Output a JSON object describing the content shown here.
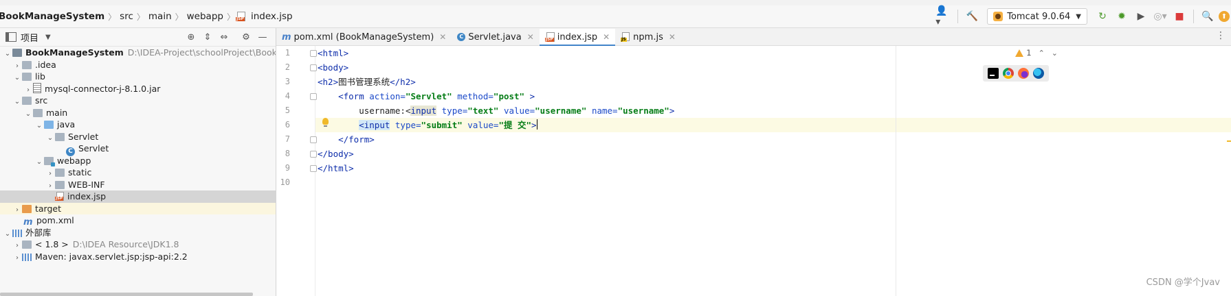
{
  "breadcrumbs": [
    "BookManageSystem",
    "src",
    "main",
    "webapp",
    "index.jsp"
  ],
  "toolbar": {
    "run_config": "Tomcat 9.0.64"
  },
  "project_panel": {
    "title": "项目",
    "tree": [
      {
        "label": "BookManageSystem",
        "path": "D:\\IDEA-Project\\schoolProject\\BookManageSyste",
        "icon": "project-folder-icon"
      },
      {
        "label": ".idea",
        "icon": "folder-icon"
      },
      {
        "label": "lib",
        "icon": "folder-icon"
      },
      {
        "label": "mysql-connector-j-8.1.0.jar",
        "icon": "jar-icon"
      },
      {
        "label": "src",
        "icon": "folder-icon"
      },
      {
        "label": "main",
        "icon": "folder-icon"
      },
      {
        "label": "java",
        "icon": "source-folder-icon"
      },
      {
        "label": "Servlet",
        "icon": "package-icon"
      },
      {
        "label": "Servlet",
        "icon": "class-icon"
      },
      {
        "label": "webapp",
        "icon": "web-folder-icon"
      },
      {
        "label": "static",
        "icon": "folder-icon"
      },
      {
        "label": "WEB-INF",
        "icon": "folder-icon"
      },
      {
        "label": "index.jsp",
        "icon": "jsp-file-icon"
      },
      {
        "label": "target",
        "icon": "excluded-folder-icon"
      },
      {
        "label": "pom.xml",
        "icon": "maven-icon"
      },
      {
        "label": "外部库",
        "icon": "libraries-icon"
      },
      {
        "label": "< 1.8 >",
        "path": "D:\\IDEA Resource\\JDK1.8",
        "icon": "jdk-folder-icon"
      },
      {
        "label": "Maven: javax.servlet.jsp:jsp-api:2.2",
        "icon": "library-icon"
      }
    ]
  },
  "tabs": [
    {
      "label": "pom.xml (BookManageSystem)",
      "icon": "maven-icon",
      "active": false
    },
    {
      "label": "Servlet.java",
      "icon": "class-icon",
      "active": false
    },
    {
      "label": "index.jsp",
      "icon": "jsp-file-icon",
      "active": true
    },
    {
      "label": "npm.js",
      "icon": "js-file-icon",
      "active": false
    }
  ],
  "editor": {
    "line_numbers": [
      "1",
      "2",
      "3",
      "4",
      "5",
      "6",
      "7",
      "8",
      "9",
      "10"
    ],
    "current_line": 6,
    "warning_count": "1",
    "lines": {
      "l1": {
        "t1": "<html>"
      },
      "l2": {
        "t1": "<body>"
      },
      "l3": {
        "t1": "<h2>",
        "text": "图书管理系统",
        "t2": "</h2>"
      },
      "l4": {
        "t1": "<form",
        "a1": "action=",
        "v1": "\"Servlet\"",
        "a2": "method=",
        "v2": "\"post\"",
        "t2": ">"
      },
      "l5": {
        "text": "username:<",
        "t1": "input",
        "a1": "type=",
        "v1": "\"text\"",
        "a2": "value=",
        "v2": "\"username\"",
        "a3": "name=",
        "v3": "\"username\"",
        "t2": ">"
      },
      "l6": {
        "t1": "<input",
        "a1": "type=",
        "v1": "\"submit\"",
        "a2": "value=",
        "v2": "\"提 交\"",
        "t2": ">"
      },
      "l7": {
        "t1": "</form>"
      },
      "l8": {
        "t1": "</body>"
      },
      "l9": {
        "t1": "</html>"
      }
    }
  },
  "watermark": "CSDN @学个Jvav",
  "colors": {
    "tag": "#0d2daa",
    "attribute": "#1b49c8",
    "string": "#067d17",
    "active_tab_underline": "#4083c9",
    "current_line_bg": "#fcfae3"
  }
}
